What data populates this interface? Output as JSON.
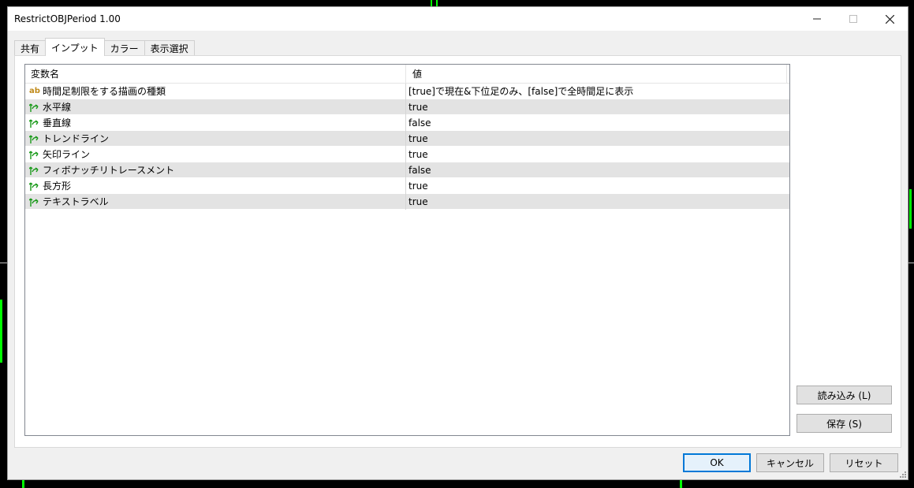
{
  "window": {
    "title": "RestrictOBJPeriod 1.00",
    "minimize_icon": "minimize-icon",
    "maximize_icon": "maximize-icon",
    "close_icon": "close-icon"
  },
  "tabs": [
    {
      "label": "共有",
      "active": false
    },
    {
      "label": "インプット",
      "active": true
    },
    {
      "label": "カラー",
      "active": false
    },
    {
      "label": "表示選択",
      "active": false
    }
  ],
  "grid": {
    "columns": {
      "name": "変数名",
      "value": "値"
    },
    "rows": [
      {
        "icon": "ab",
        "name": "時間足制限をする描画の種類",
        "value": "[true]で現在&下位足のみ、[false]で全時間足に表示"
      },
      {
        "icon": "arrow",
        "name": "水平線",
        "value": "true"
      },
      {
        "icon": "arrow",
        "name": "垂直線",
        "value": "false"
      },
      {
        "icon": "arrow",
        "name": "トレンドライン",
        "value": "true"
      },
      {
        "icon": "arrow",
        "name": "矢印ライン",
        "value": "true"
      },
      {
        "icon": "arrow",
        "name": "フィボナッチリトレースメント",
        "value": "false"
      },
      {
        "icon": "arrow",
        "name": "長方形",
        "value": "true"
      },
      {
        "icon": "arrow",
        "name": "テキストラベル",
        "value": "true"
      }
    ]
  },
  "side_buttons": {
    "load": "読み込み (L)",
    "save": "保存 (S)"
  },
  "footer_buttons": {
    "ok": "OK",
    "cancel": "キャンセル",
    "reset": "リセット"
  },
  "colors": {
    "accent": "#0078d7",
    "row_alt": "#e3e3e3",
    "bool_icon": "#1a9a1a",
    "string_icon": "#c08a1a"
  }
}
